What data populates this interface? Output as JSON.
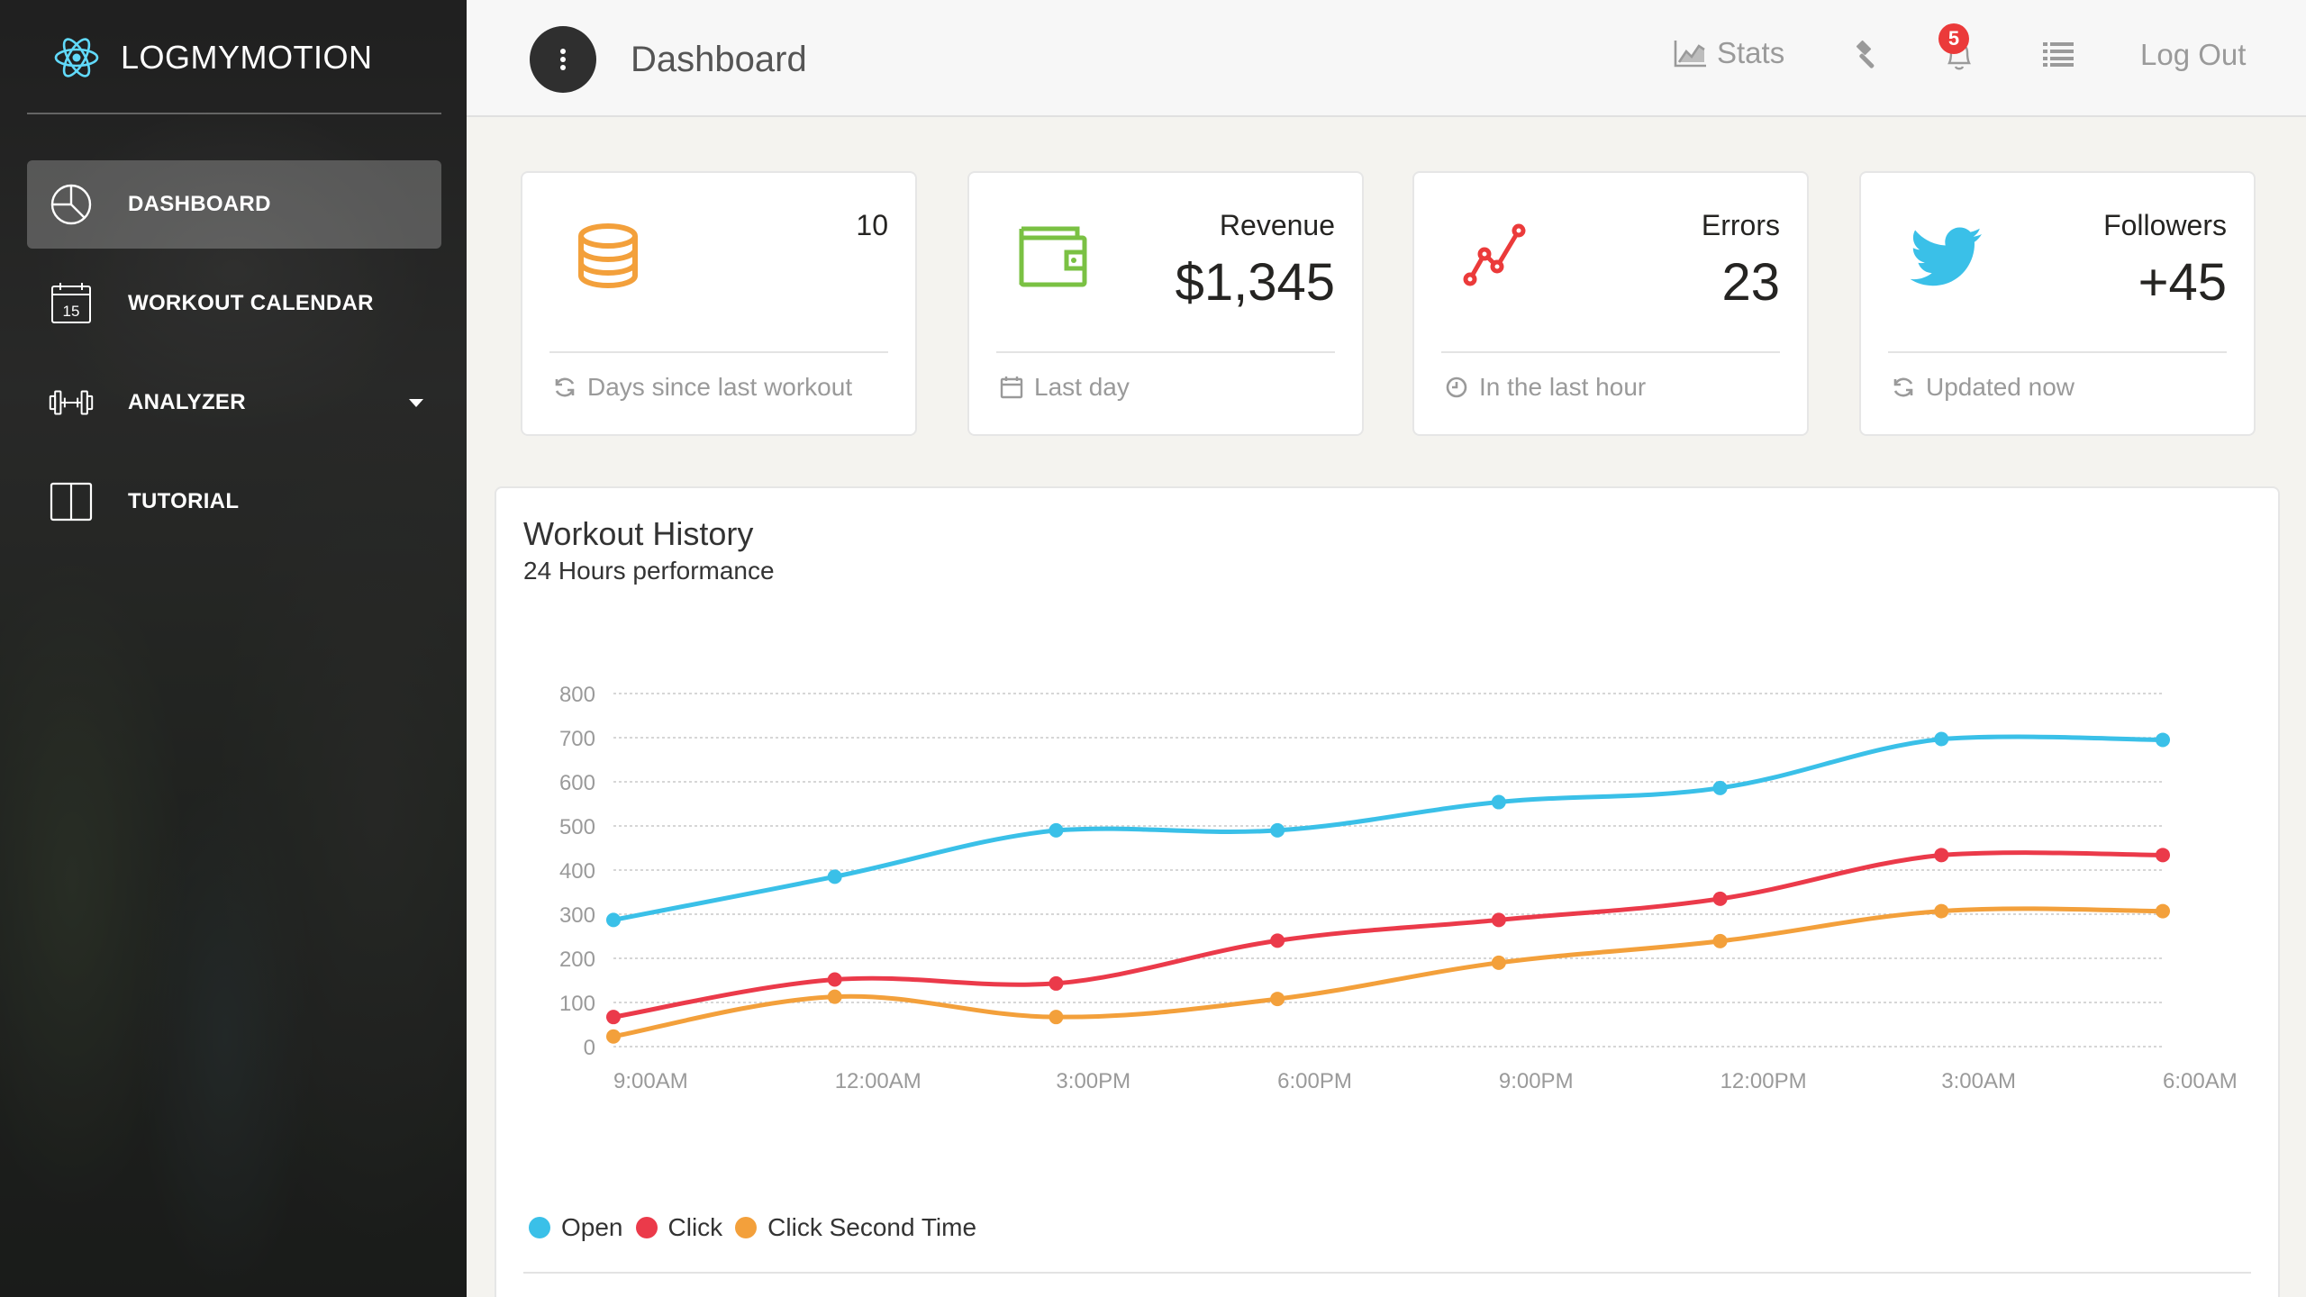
{
  "app": {
    "name": "LOGMYMOTION"
  },
  "sidebar": {
    "items": [
      {
        "label": "DASHBOARD",
        "icon": "pie-chart-icon",
        "active": true
      },
      {
        "label": "WORKOUT CALENDAR",
        "icon": "calendar-icon",
        "calendar_day": "15"
      },
      {
        "label": "ANALYZER",
        "icon": "dumbbell-icon",
        "has_dropdown": true
      },
      {
        "label": "TUTORIAL",
        "icon": "book-icon"
      }
    ]
  },
  "header": {
    "title": "Dashboard",
    "stats_label": "Stats",
    "notification_count": "5",
    "logout_label": "Log Out"
  },
  "cards": [
    {
      "icon": "database-icon",
      "color": "#f3a03b",
      "label": "",
      "value": "10",
      "footer": "Days since last workout",
      "footer_icon": "refresh-icon"
    },
    {
      "icon": "wallet-icon",
      "color": "#7ac143",
      "label": "Revenue",
      "value": "$1,345",
      "footer": "Last day",
      "footer_icon": "calendar-small-icon"
    },
    {
      "icon": "trend-icon",
      "color": "#eb3a3a",
      "label": "Errors",
      "value": "23",
      "footer": "In the last hour",
      "footer_icon": "clock-icon"
    },
    {
      "icon": "twitter-icon",
      "color": "#3ac0e8",
      "label": "Followers",
      "value": "+45",
      "footer": "Updated now",
      "footer_icon": "refresh-icon"
    }
  ],
  "chart": {
    "title": "Workout History",
    "subtitle": "24 Hours performance"
  },
  "chart_data": {
    "type": "line",
    "x": [
      "9:00AM",
      "12:00AM",
      "3:00PM",
      "6:00PM",
      "9:00PM",
      "12:00PM",
      "3:00AM",
      "6:00AM"
    ],
    "ylim": [
      0,
      800
    ],
    "yticks": [
      0,
      100,
      200,
      300,
      400,
      500,
      600,
      700,
      800
    ],
    "grid": true,
    "legend_position": "bottom-left",
    "series": [
      {
        "name": "Open",
        "color": "#3ac0e8",
        "values": [
          287,
          385,
          490,
          490,
          554,
          586,
          697,
          695
        ]
      },
      {
        "name": "Click",
        "color": "#eb3a4a",
        "values": [
          67,
          152,
          143,
          240,
          287,
          335,
          434,
          434
        ]
      },
      {
        "name": "Click Second Time",
        "color": "#f3a03b",
        "values": [
          23,
          113,
          67,
          108,
          190,
          239,
          307,
          307
        ]
      }
    ]
  }
}
